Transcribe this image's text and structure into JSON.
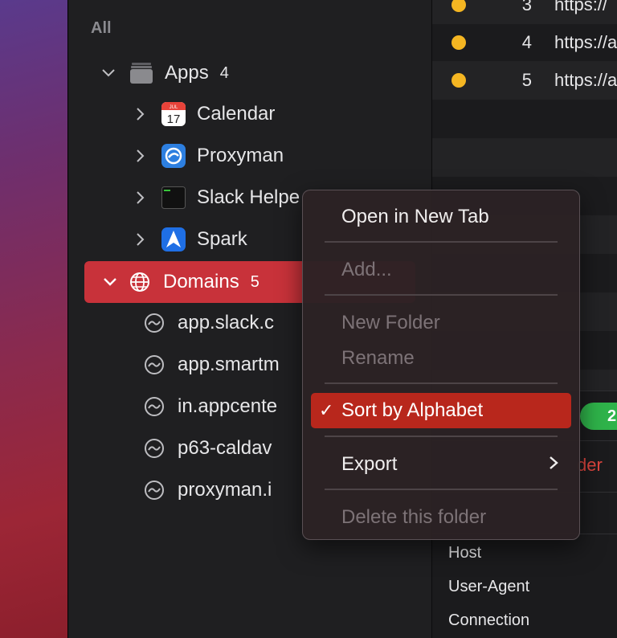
{
  "sidebar": {
    "section_label": "All",
    "apps": {
      "label": "Apps",
      "count": "4",
      "children": [
        {
          "label": "Calendar",
          "icon": "calendar-icon",
          "calendar_month": "JUL",
          "calendar_day": "17"
        },
        {
          "label": "Proxyman",
          "icon": "proxyman-icon"
        },
        {
          "label": "Slack Helpe",
          "icon": "terminal-icon"
        },
        {
          "label": "Spark",
          "icon": "spark-icon"
        }
      ]
    },
    "domains": {
      "label": "Domains",
      "count": "5",
      "children": [
        {
          "label": "app.slack.c"
        },
        {
          "label": "app.smartm"
        },
        {
          "label": "in.appcente"
        },
        {
          "label": "p63-caldav"
        },
        {
          "label": "proxyman.i"
        }
      ]
    }
  },
  "requests": [
    {
      "num": "3",
      "url": "https://"
    },
    {
      "num": "4",
      "url": "https://a"
    },
    {
      "num": "5",
      "url": "https://a"
    }
  ],
  "detail": {
    "status_badge": "2",
    "red_text": "der",
    "headers": [
      "Host",
      "User-Agent",
      "Connection"
    ]
  },
  "context_menu": {
    "open_new_tab": "Open in New Tab",
    "add": "Add...",
    "new_folder": "New Folder",
    "rename": "Rename",
    "sort_alphabet": "Sort by Alphabet",
    "checkmark": "✓",
    "export": "Export",
    "delete_folder": "Delete this folder"
  },
  "colors": {
    "selection": "#c8323a",
    "menu_highlight": "#b8271c",
    "status_dot": "#f5b622",
    "status_green": "#2fb34a"
  }
}
